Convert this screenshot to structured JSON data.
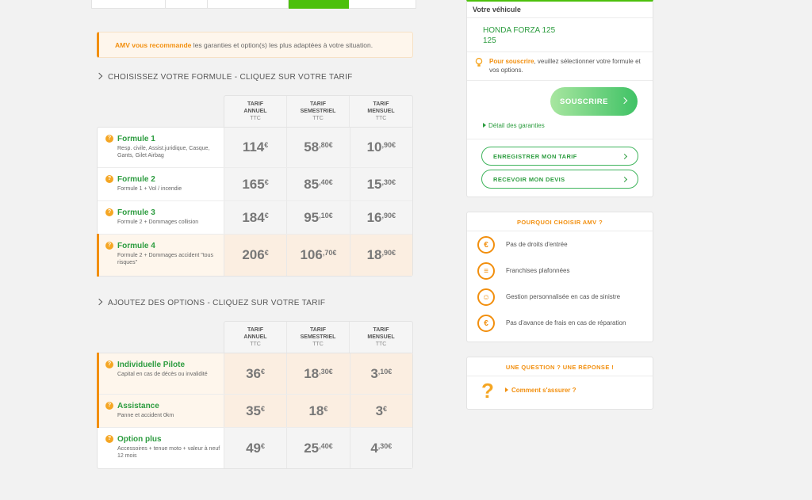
{
  "banner": {
    "strong": "AMV vous recommande",
    "text": " les garanties et option(s) les plus adaptées à votre situation."
  },
  "formules": {
    "title": "CHOISISSEZ VOTRE FORMULE - CLIQUEZ SUR VOTRE TARIF",
    "headers": [
      {
        "l1": "TARIF",
        "l2": "ANNUEL",
        "ttc": "TTC"
      },
      {
        "l1": "TARIF",
        "l2": "SEMESTRIEL",
        "ttc": "TTC"
      },
      {
        "l1": "TARIF",
        "l2": "MENSUEL",
        "ttc": "TTC"
      }
    ],
    "rows": [
      {
        "name": "Formule 1",
        "desc": "Resp. civile, Assist.juridique, Casque, Gants, Gilet Airbag",
        "prices": [
          {
            "int": "114",
            "dec": "€"
          },
          {
            "int": "58",
            "dec": ",80€"
          },
          {
            "int": "10",
            "dec": ",90€"
          }
        ]
      },
      {
        "name": "Formule 2",
        "desc": "Formule 1 + Vol / incendie",
        "prices": [
          {
            "int": "165",
            "dec": "€"
          },
          {
            "int": "85",
            "dec": ",40€"
          },
          {
            "int": "15",
            "dec": ",30€"
          }
        ]
      },
      {
        "name": "Formule 3",
        "desc": "Formule 2 + Dommages collision",
        "prices": [
          {
            "int": "184",
            "dec": "€"
          },
          {
            "int": "95",
            "dec": ",10€"
          },
          {
            "int": "16",
            "dec": ",90€"
          }
        ]
      },
      {
        "name": "Formule 4",
        "desc": "Formule 2 + Dommages accident \"tous risques\"",
        "prices": [
          {
            "int": "206",
            "dec": "€"
          },
          {
            "int": "106",
            "dec": ",70€"
          },
          {
            "int": "18",
            "dec": ",90€"
          }
        ]
      }
    ]
  },
  "options": {
    "title": "AJOUTEZ DES OPTIONS - CLIQUEZ SUR VOTRE TARIF",
    "headers": [
      {
        "l1": "TARIF",
        "l2": "ANNUEL",
        "ttc": "TTC"
      },
      {
        "l1": "TARIF",
        "l2": "SEMESTRIEL",
        "ttc": "TTC"
      },
      {
        "l1": "TARIF",
        "l2": "MENSUEL",
        "ttc": "TTC"
      }
    ],
    "rows": [
      {
        "name": "Individuelle Pilote",
        "desc": "Capital en cas de décès ou invalidité",
        "prices": [
          {
            "int": "36",
            "dec": "€"
          },
          {
            "int": "18",
            "dec": ",30€"
          },
          {
            "int": "3",
            "dec": ",10€"
          }
        ]
      },
      {
        "name": "Assistance",
        "desc": "Panne et accident 0km",
        "prices": [
          {
            "int": "35",
            "dec": "€"
          },
          {
            "int": "18",
            "dec": "€"
          },
          {
            "int": "3",
            "dec": "€"
          }
        ]
      },
      {
        "name": "Option plus",
        "desc": "Accessoires + tenue moto + valeur à neuf 12 mois",
        "prices": [
          {
            "int": "49",
            "dec": "€"
          },
          {
            "int": "25",
            "dec": ",40€"
          },
          {
            "int": "4",
            "dec": ",30€"
          }
        ]
      }
    ]
  },
  "vehicle": {
    "title": "Votre véhicule",
    "model": "HONDA FORZA 125",
    "cc": "125",
    "tip_strong": "Pour souscrire",
    "tip_text": ", veuillez sélectionner votre formule et vos options.",
    "subscribe": "SOUSCRIRE",
    "detail": "Détail des garanties",
    "save": "ENREGISTRER MON TARIF",
    "quote": "RECEVOIR MON DEVIS"
  },
  "why": {
    "title": "POURQUOI CHOISIR AMV ?",
    "items": [
      {
        "icon": "no-fee-icon",
        "text": "Pas de droits d'entrée"
      },
      {
        "icon": "coins-icon",
        "text": "Franchises plafonnées"
      },
      {
        "icon": "person-icon",
        "text": "Gestion personnalisée en cas de sinistre"
      },
      {
        "icon": "no-advance-icon",
        "text": "Pas d'avance de frais en cas de réparation"
      }
    ]
  },
  "faq": {
    "title": "UNE QUESTION ? UNE RÉPONSE !",
    "link": "Comment s'assurer ?"
  },
  "colors": {
    "green": "#2c9c3f",
    "orange": "#f28f0e",
    "progress": "#4cc00c"
  }
}
